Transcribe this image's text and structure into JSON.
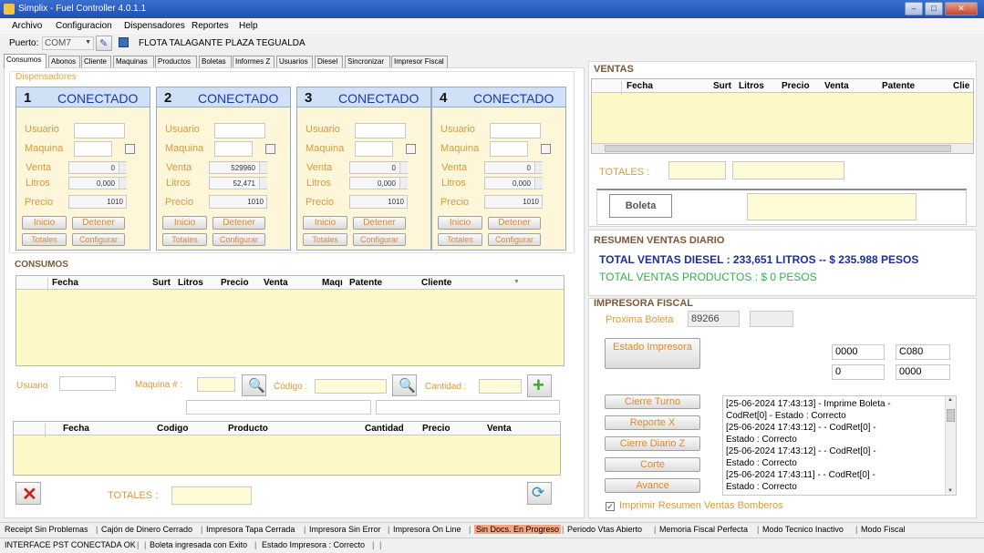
{
  "window": {
    "title": "Simplix - Fuel Controller 4.0.1.1"
  },
  "menu": [
    "Archivo",
    "Configuracion",
    "Dispensadores",
    "Reportes",
    "Help"
  ],
  "port": {
    "label": "Puerto:",
    "value": "COM7",
    "station": "FLOTA TALAGANTE PLAZA TEGUALDA"
  },
  "tabs": [
    "Consumos",
    "Abonos",
    "Cliente",
    "Maquinas",
    "Productos",
    "Boletas",
    "Informes Z",
    "Usuarios",
    "Diesel",
    "Sincronizar",
    "Impresor Fiscal"
  ],
  "dispensers": {
    "title": "Dispensadores",
    "labels": {
      "usuario": "Usuario",
      "maquina": "Maquina",
      "venta": "Venta",
      "litros": "Litros",
      "precio": "Precio",
      "inicio": "Inicio",
      "detener": "Detener",
      "totales": "Totales",
      "configurar": "Configurar"
    },
    "cards": [
      {
        "number": "1",
        "status": "CONECTADO",
        "venta": "0",
        "litros": "0,000",
        "precio": "1010"
      },
      {
        "number": "2",
        "status": "CONECTADO",
        "venta": "529960",
        "litros": "52,471",
        "precio": "1010"
      },
      {
        "number": "3",
        "status": "CONECTADO",
        "venta": "0",
        "litros": "0,000",
        "precio": "1010"
      },
      {
        "number": "4",
        "status": "CONECTADO",
        "venta": "0",
        "litros": "0,000",
        "precio": "1010"
      }
    ]
  },
  "consumos": {
    "title": "CONSUMOS",
    "columns": [
      "Fecha",
      "Surt",
      "Litros",
      "Precio",
      "Venta",
      "Maqı",
      "Patente",
      "Cliente"
    ],
    "form": {
      "usuario": "Usuario",
      "maquina": "Maquina # :",
      "codigo": "Código :",
      "cantidad": "Cantidad :"
    },
    "products_columns": [
      "Fecha",
      "Codigo",
      "Producto",
      "Cantidad",
      "Precio",
      "Venta"
    ],
    "totales": "TOTALES :"
  },
  "ventas": {
    "title": "VENTAS",
    "columns": [
      "Fecha",
      "Surt",
      "Litros",
      "Precio",
      "Venta",
      "Patente",
      "Clie"
    ],
    "totales": "TOTALES :",
    "boleta": "Boleta"
  },
  "resumen": {
    "title": "RESUMEN VENTAS DIARIO",
    "diesel": "TOTAL VENTAS DIESEL : 233,651 LITROS --   $ 235.988 PESOS",
    "productos": "TOTAL VENTAS PRODUCTOS : $ 0 PESOS"
  },
  "impresora": {
    "title": "IMPRESORA FISCAL",
    "proxima_label": "Proxima Boleta",
    "proxima_value": "89266",
    "estado": "Estado Impresora",
    "fields": [
      "0000",
      "C080",
      "0",
      "0000"
    ],
    "buttons": [
      "Cierre Turno",
      "Reporte X",
      "Cierre Diario Z",
      "Corte",
      "Avance"
    ],
    "log": [
      "[25-06-2024 17:43:13] - Imprime Boleta -",
      "CodRet[0] -  Estado : Correcto",
      "[25-06-2024 17:43:12] - - CodRet[0] -",
      "Estado : Correcto",
      "[25-06-2024 17:43:12] - - CodRet[0] -",
      "Estado : Correcto",
      "[25-06-2024 17:43:11] - - CodRet[0] -",
      "Estado : Correcto"
    ],
    "checkbox": "Imprimir Resumen Ventas Bomberos"
  },
  "status1": [
    "Receipt Sin Problemas",
    "Cajón de Dinero Cerrado",
    "Impresora Tapa Cerrada",
    "Impresora Sin Error",
    "Impresora On Line",
    "Sin Docs. En Progreso",
    "Periodo Vtas Abierto",
    "Memoria Fiscal Perfecta",
    "Modo Tecnico Inactivo",
    "Modo Fiscal"
  ],
  "status2": [
    "INTERFACE PST CONECTADA OK",
    "Boleta ingresada con Exito",
    "Estado Impresora : Correcto"
  ],
  "colors": {
    "accent": "#2036a8",
    "label": "#d89a3a",
    "green": "#2fb34a",
    "highlight": "#f4a582"
  }
}
